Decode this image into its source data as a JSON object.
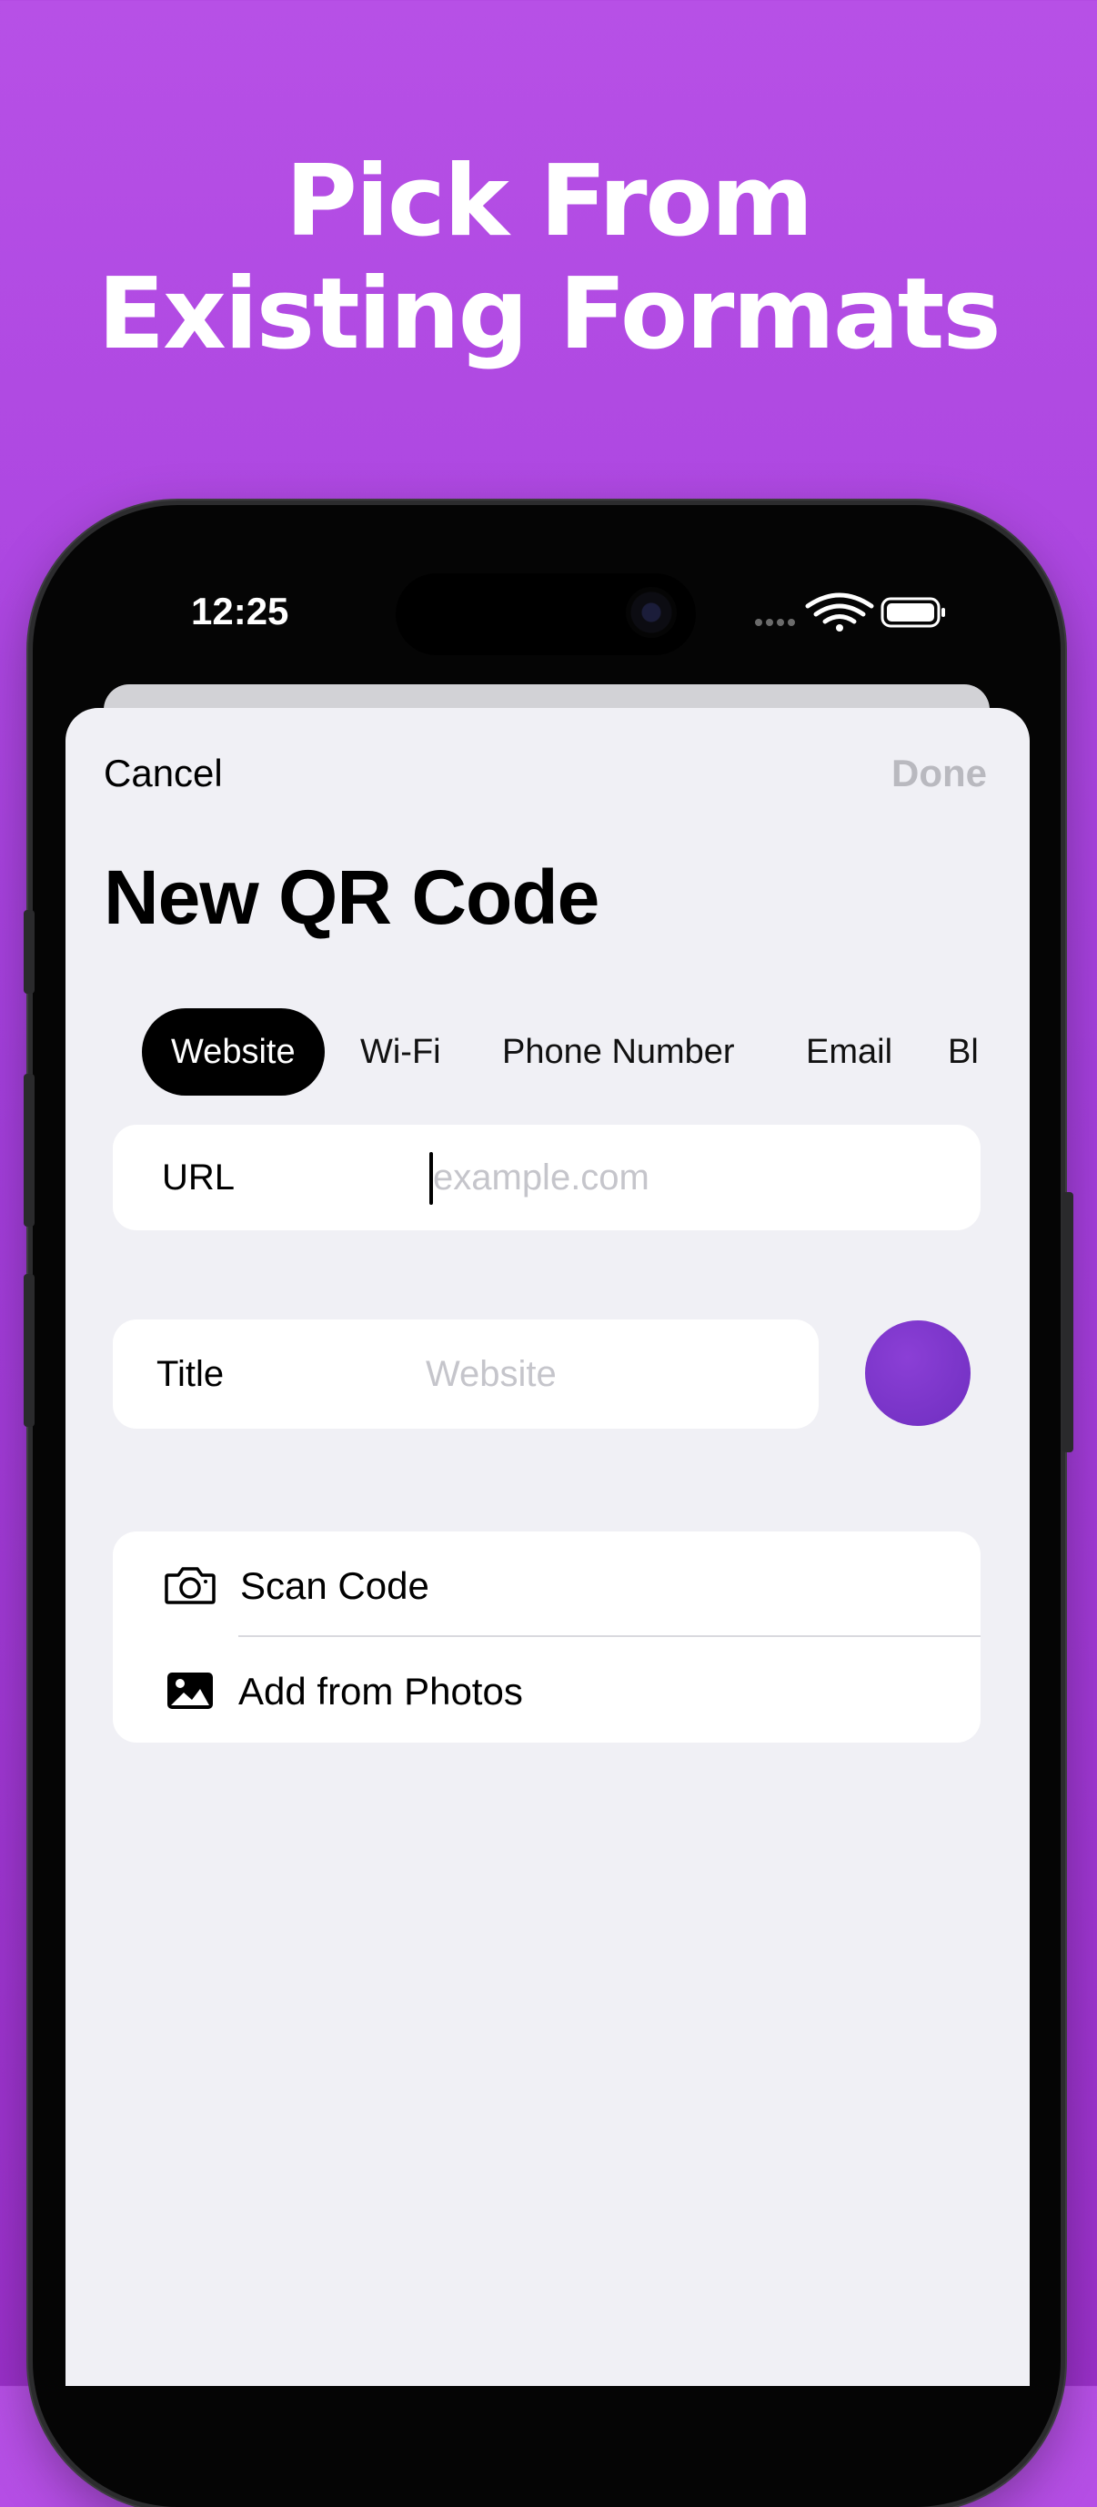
{
  "headline": {
    "line1": "Pick From",
    "line2": "Existing Formats"
  },
  "status_bar": {
    "time": "12:25",
    "icons": [
      "signal-dots-icon",
      "wifi-icon",
      "battery-icon"
    ]
  },
  "nav": {
    "cancel_label": "Cancel",
    "done_label": "Done",
    "title": "New QR Code"
  },
  "tabs": [
    {
      "label": "Website",
      "active": true
    },
    {
      "label": "Wi-Fi",
      "active": false
    },
    {
      "label": "Phone Number",
      "active": false
    },
    {
      "label": "Email",
      "active": false
    },
    {
      "label": "Bl",
      "active": false
    }
  ],
  "url_field": {
    "label": "URL",
    "placeholder": "example.com"
  },
  "title_field": {
    "label": "Title",
    "placeholder": "Website"
  },
  "color_swatch": {
    "color": "#7d36cc"
  },
  "import_actions": [
    {
      "label": "Scan Code",
      "icon": "camera-icon"
    },
    {
      "label": "Add from Photos",
      "icon": "photo-icon"
    }
  ],
  "colors": {
    "background": "#b14ae2",
    "sheet": "#f0f0f5",
    "done_disabled": "#b9b9bf"
  }
}
